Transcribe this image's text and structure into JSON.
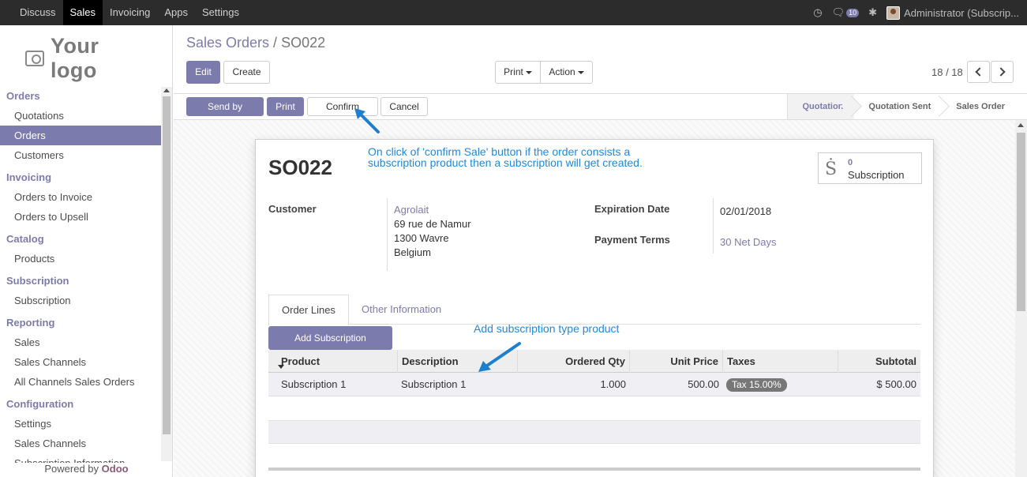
{
  "topbar": {
    "menu": [
      "Discuss",
      "Sales",
      "Invoicing",
      "Apps",
      "Settings"
    ],
    "active": "Sales",
    "messages_count": "10",
    "user": "Administrator (Subscrip..."
  },
  "sidebar": {
    "logo_text": "Your logo",
    "sections": [
      {
        "title": "Orders",
        "items": [
          "Quotations",
          "Orders",
          "Customers"
        ]
      },
      {
        "title": "Invoicing",
        "items": [
          "Orders to Invoice",
          "Orders to Upsell"
        ]
      },
      {
        "title": "Catalog",
        "items": [
          "Products"
        ]
      },
      {
        "title": "Subscription",
        "items": [
          "Subscription"
        ]
      },
      {
        "title": "Reporting",
        "items": [
          "Sales",
          "Sales Channels",
          "All Channels Sales Orders"
        ]
      },
      {
        "title": "Configuration",
        "items": [
          "Settings",
          "Sales Channels",
          "Subscription Information"
        ]
      }
    ],
    "active_item": "Orders",
    "powered_by": "Powered by",
    "powered_brand": "Odoo"
  },
  "control": {
    "breadcrumb_parent": "Sales Orders",
    "breadcrumb_sep": " / ",
    "breadcrumb_current": "SO022",
    "edit": "Edit",
    "create": "Create",
    "print": "Print",
    "action": "Action",
    "pager": "18 / 18"
  },
  "statusbar": {
    "send_email": "Send by Email",
    "print": "Print",
    "confirm": "Confirm Sale",
    "cancel": "Cancel",
    "steps": [
      "Quotation",
      "Quotation Sent",
      "Sales Order"
    ]
  },
  "form": {
    "name": "SO022",
    "note_confirm_line1": "On click of 'confirm Sale' button if the order consists a",
    "note_confirm_line2": "subscription product then a subscription will get created.",
    "note_product": "Add subscription type product",
    "subscription_count": "0",
    "subscription_label": "Subscription",
    "customer_label": "Customer",
    "customer_name": "Agrolait",
    "customer_addr1": "69 rue de Namur",
    "customer_addr2": "1300 Wavre",
    "customer_addr3": "Belgium",
    "expiration_label": "Expiration Date",
    "expiration_value": "02/01/2018",
    "payment_label": "Payment Terms",
    "payment_value": "30 Net Days",
    "tab_lines": "Order Lines",
    "tab_other": "Other Information",
    "add_sub_product": "Add Subscription Product"
  },
  "table": {
    "headers": [
      "Product",
      "Description",
      "Ordered Qty",
      "Unit Price",
      "Taxes",
      "Subtotal"
    ],
    "rows": [
      {
        "product": "Subscription 1",
        "description": "Subscription 1",
        "qty": "1.000",
        "price": "500.00",
        "tax": "Tax 15.00%",
        "subtotal": "$ 500.00"
      }
    ]
  }
}
